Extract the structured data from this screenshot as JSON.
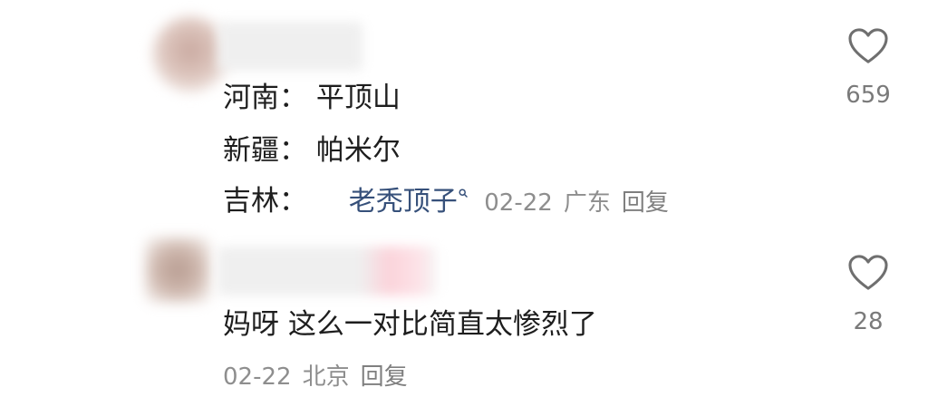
{
  "comments": [
    {
      "lines": [
        "河南： 平顶山",
        "新疆： 帕米尔"
      ],
      "last_line_prefix": "吉林：",
      "mention": "老秃顶子",
      "date": "02-22",
      "location": "广东",
      "reply_label": "回复",
      "like_count": "659"
    },
    {
      "text": "妈呀 这么一对比简直太惨烈了",
      "date": "02-22",
      "location": "北京",
      "reply_label": "回复",
      "like_count": "28"
    }
  ],
  "icons": {
    "like": "heart-outline-icon",
    "mention_search": "search-icon"
  },
  "colors": {
    "text": "#1e1e1e",
    "mention": "#36507a",
    "meta": "#8e8e8e",
    "icon": "#6f6f6f"
  }
}
